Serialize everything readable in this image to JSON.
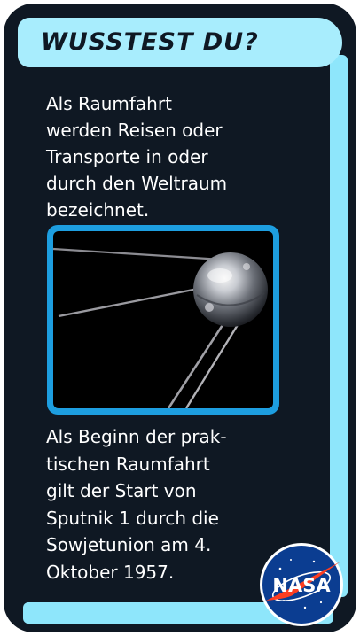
{
  "card": {
    "title": "WUSSTEST DU?",
    "paragraph_1": "Als Raumfahrt\nwerden Reisen oder\nTransporte in oder\ndurch den Weltraum\nbezeichnet.",
    "paragraph_2": "Als Beginn der prak-\ntischen Raumfahrt\ngilt der Start von\nSputnik 1 durch die\nSowjetunion am 4.\nOktober 1957."
  },
  "logo": {
    "text": "NASA"
  },
  "icons": {
    "photo": "sputnik-satellite-photo",
    "logo": "nasa-meatball-logo"
  },
  "colors": {
    "background": "#0f1823",
    "accent_light": "#a8edfd",
    "accent": "#8ee6fb",
    "frame": "#1d9ee0",
    "nasa_blue": "#0b3d91",
    "nasa_red": "#fc3d21"
  }
}
